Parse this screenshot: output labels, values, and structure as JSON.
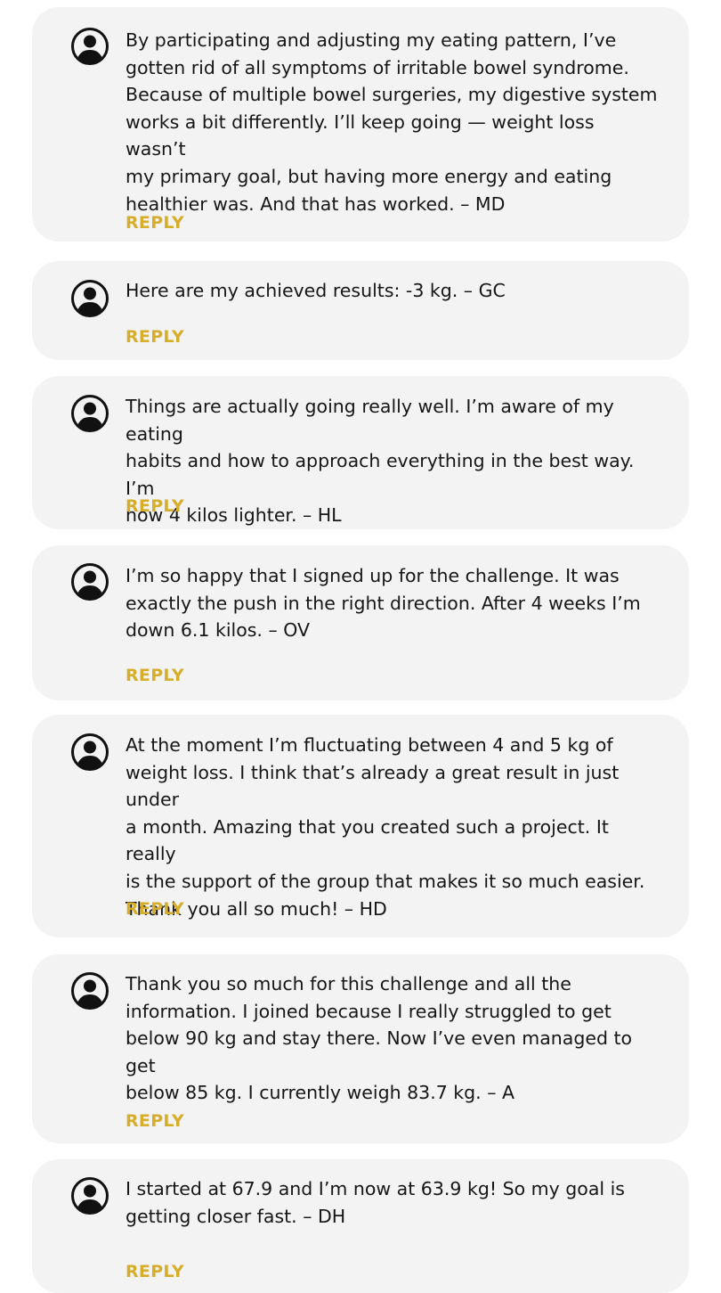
{
  "reply_label": "REPLY",
  "colors": {
    "card_background": "#f3f3f3",
    "reply_accent": "#d6ae2c",
    "text": "#161616",
    "avatar": "#111111"
  },
  "avatar_icon": "user-circle-icon",
  "comments": [
    {
      "text": "By participating and adjusting my eating pattern, I’ve\ngotten rid of all symptoms of irritable bowel syndrome.\nBecause of multiple bowel surgeries, my digestive system\nworks a bit differently. I’ll keep going — weight loss wasn’t\nmy primary goal, but having more energy and eating\nhealthier was. And that has worked. – MD"
    },
    {
      "text": "Here are my achieved results: -3 kg. – GC"
    },
    {
      "text": "Things are actually going really well. I’m aware of my eating\nhabits and how to approach everything in the best way. I’m\nnow 4 kilos lighter. – HL"
    },
    {
      "text": "I’m so happy that I signed up for the challenge. It was\nexactly the push in the right direction. After 4 weeks I’m\ndown 6.1 kilos. – OV"
    },
    {
      "text": "At the moment I’m fluctuating between 4 and 5 kg of\nweight loss. I think that’s already a great result in just under\na month. Amazing that you created such a project. It really\nis the support of the group that makes it so much easier.\nThank you all so much! – HD"
    },
    {
      "text": "Thank you so much for this challenge and all the\ninformation. I joined because I really struggled to get\nbelow 90 kg and stay there. Now I’ve even managed to get\nbelow 85 kg. I currently weigh 83.7 kg. – A"
    },
    {
      "text": "I started at 67.9 and I’m now at 63.9 kg! So my goal is\ngetting closer fast. – DH"
    }
  ]
}
